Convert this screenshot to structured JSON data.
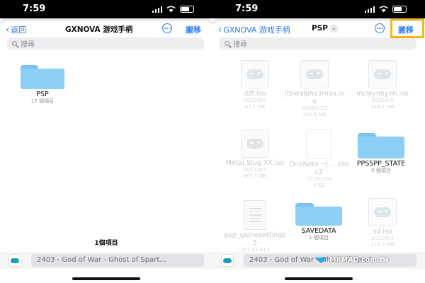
{
  "status": {
    "time": "7:59"
  },
  "left": {
    "nav": {
      "back_label": "返回",
      "title": "GXNOVA 游戏手柄",
      "move_label": "搬移"
    },
    "search": {
      "placeholder": "搜尋"
    },
    "items": [
      {
        "name": "PSP",
        "meta": "17 個項目"
      }
    ],
    "count": "1個項目",
    "bottom": {
      "field_text": "2403 - God of War - Ghost of Spart..."
    }
  },
  "right": {
    "nav": {
      "back_label": "GXNOVA 游戏手柄",
      "title": "PSP",
      "move_label": "搬移"
    },
    "search": {
      "placeholder": "搜尋"
    },
    "items": [
      {
        "name": "dzt.iso",
        "meta1": "2018/8/5",
        "meta2": "63.1 MB",
        "kind": "iso"
      },
      {
        "name": "jtbwalpha3max.iso",
        "meta1": "2006/1/29",
        "meta2": "246.8 MB",
        "kind": "iso"
      },
      {
        "name": "mcwynhynh.iso",
        "meta1": "2018/8/5",
        "meta2": "328.7 MB",
        "kind": "iso"
      },
      {
        "name": "Metal Slug XX.iso",
        "meta1": "2017/4/2",
        "meta2": "483.7 MB",
        "kind": "iso"
      },
      {
        "name": "OneNote ─┤ ...etoc2",
        "meta1": "2018/11/8",
        "meta2": "4 KB",
        "kind": "note"
      },
      {
        "name": "PPSSPP_STATE",
        "meta1": "0 個項目",
        "meta2": "",
        "kind": "folder"
      },
      {
        "name": "psp_gamesettings5",
        "meta1": "2017/12/11",
        "meta2": "",
        "kind": "doc"
      },
      {
        "name": "SAVEDATA",
        "meta1": "1 個項目",
        "meta2": "",
        "kind": "folder"
      },
      {
        "name": "sd.iso",
        "meta1": "2013/6/3",
        "meta2": "223.5 MB",
        "kind": "iso"
      }
    ],
    "bottom": {
      "field_text": "2403 - God of War - Ghost of Spart..."
    }
  },
  "watermark": {
    "text": "MRMAD.com.tw"
  },
  "colors": {
    "accent": "#2f7bf5",
    "highlight": "#f7b51a",
    "folder": "#8dcff4"
  }
}
